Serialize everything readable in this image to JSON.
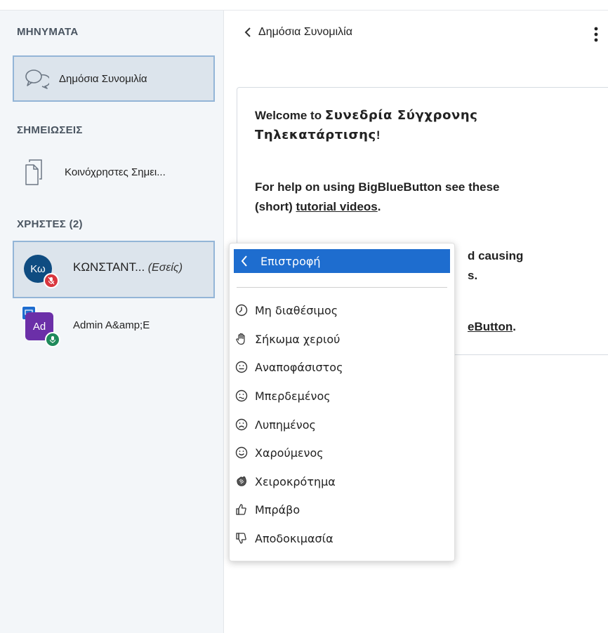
{
  "sidebar": {
    "messages_title": "ΜΗΝΥΜΑΤΑ",
    "public_chat_label": "Δημόσια Συνομιλία",
    "notes_title": "ΣΗΜΕΙΩΣΕΙΣ",
    "shared_notes_label": "Κοινόχρηστες Σημει...",
    "users_title": "ΧΡΗΣΤΕΣ (2)",
    "users": [
      {
        "initials": "Κω",
        "name": "ΚΩΝΣΤΑΝΤ...",
        "you": "(Εσείς)"
      },
      {
        "initials": "Ad",
        "name": "Admin A&amp;E"
      }
    ]
  },
  "chat": {
    "title": "Δημόσια Συνομιλία",
    "welcome_1": "Welcome to ",
    "welcome_session": "Συνεδρία Σύγχρονης Τηλεκατάρτισης",
    "welcome_end": "!",
    "help_1": "For help on using BigBlueButton see these",
    "help_2": "(short) ",
    "help_link": "tutorial videos",
    "help_end": ".",
    "partial_line_1": "d causing",
    "partial_line_2": "s.",
    "partial_link": "eButton",
    "partial_end": "."
  },
  "menu": {
    "back_label": "Επιστροφή",
    "items": [
      {
        "label": "Μη διαθέσιμος",
        "icon": "clock-icon"
      },
      {
        "label": "Σήκωμα χεριού",
        "icon": "hand-icon"
      },
      {
        "label": "Αναποφάσιστος",
        "icon": "neutral-face-icon"
      },
      {
        "label": "Μπερδεμένος",
        "icon": "confused-face-icon"
      },
      {
        "label": "Λυπημένος",
        "icon": "sad-face-icon"
      },
      {
        "label": "Χαρούμενος",
        "icon": "happy-face-icon"
      },
      {
        "label": "Χειροκρότημα",
        "icon": "applause-icon"
      },
      {
        "label": "Μπράβο",
        "icon": "thumbs-up-icon"
      },
      {
        "label": "Αποδοκιμασία",
        "icon": "thumbs-down-icon"
      }
    ]
  },
  "colors": {
    "accent": "#1e6dcf",
    "avatar_user": "#0f4c81",
    "avatar_admin": "#6b2fa8",
    "badge_muted": "#d9363e",
    "badge_mic": "#1f8a5b"
  }
}
